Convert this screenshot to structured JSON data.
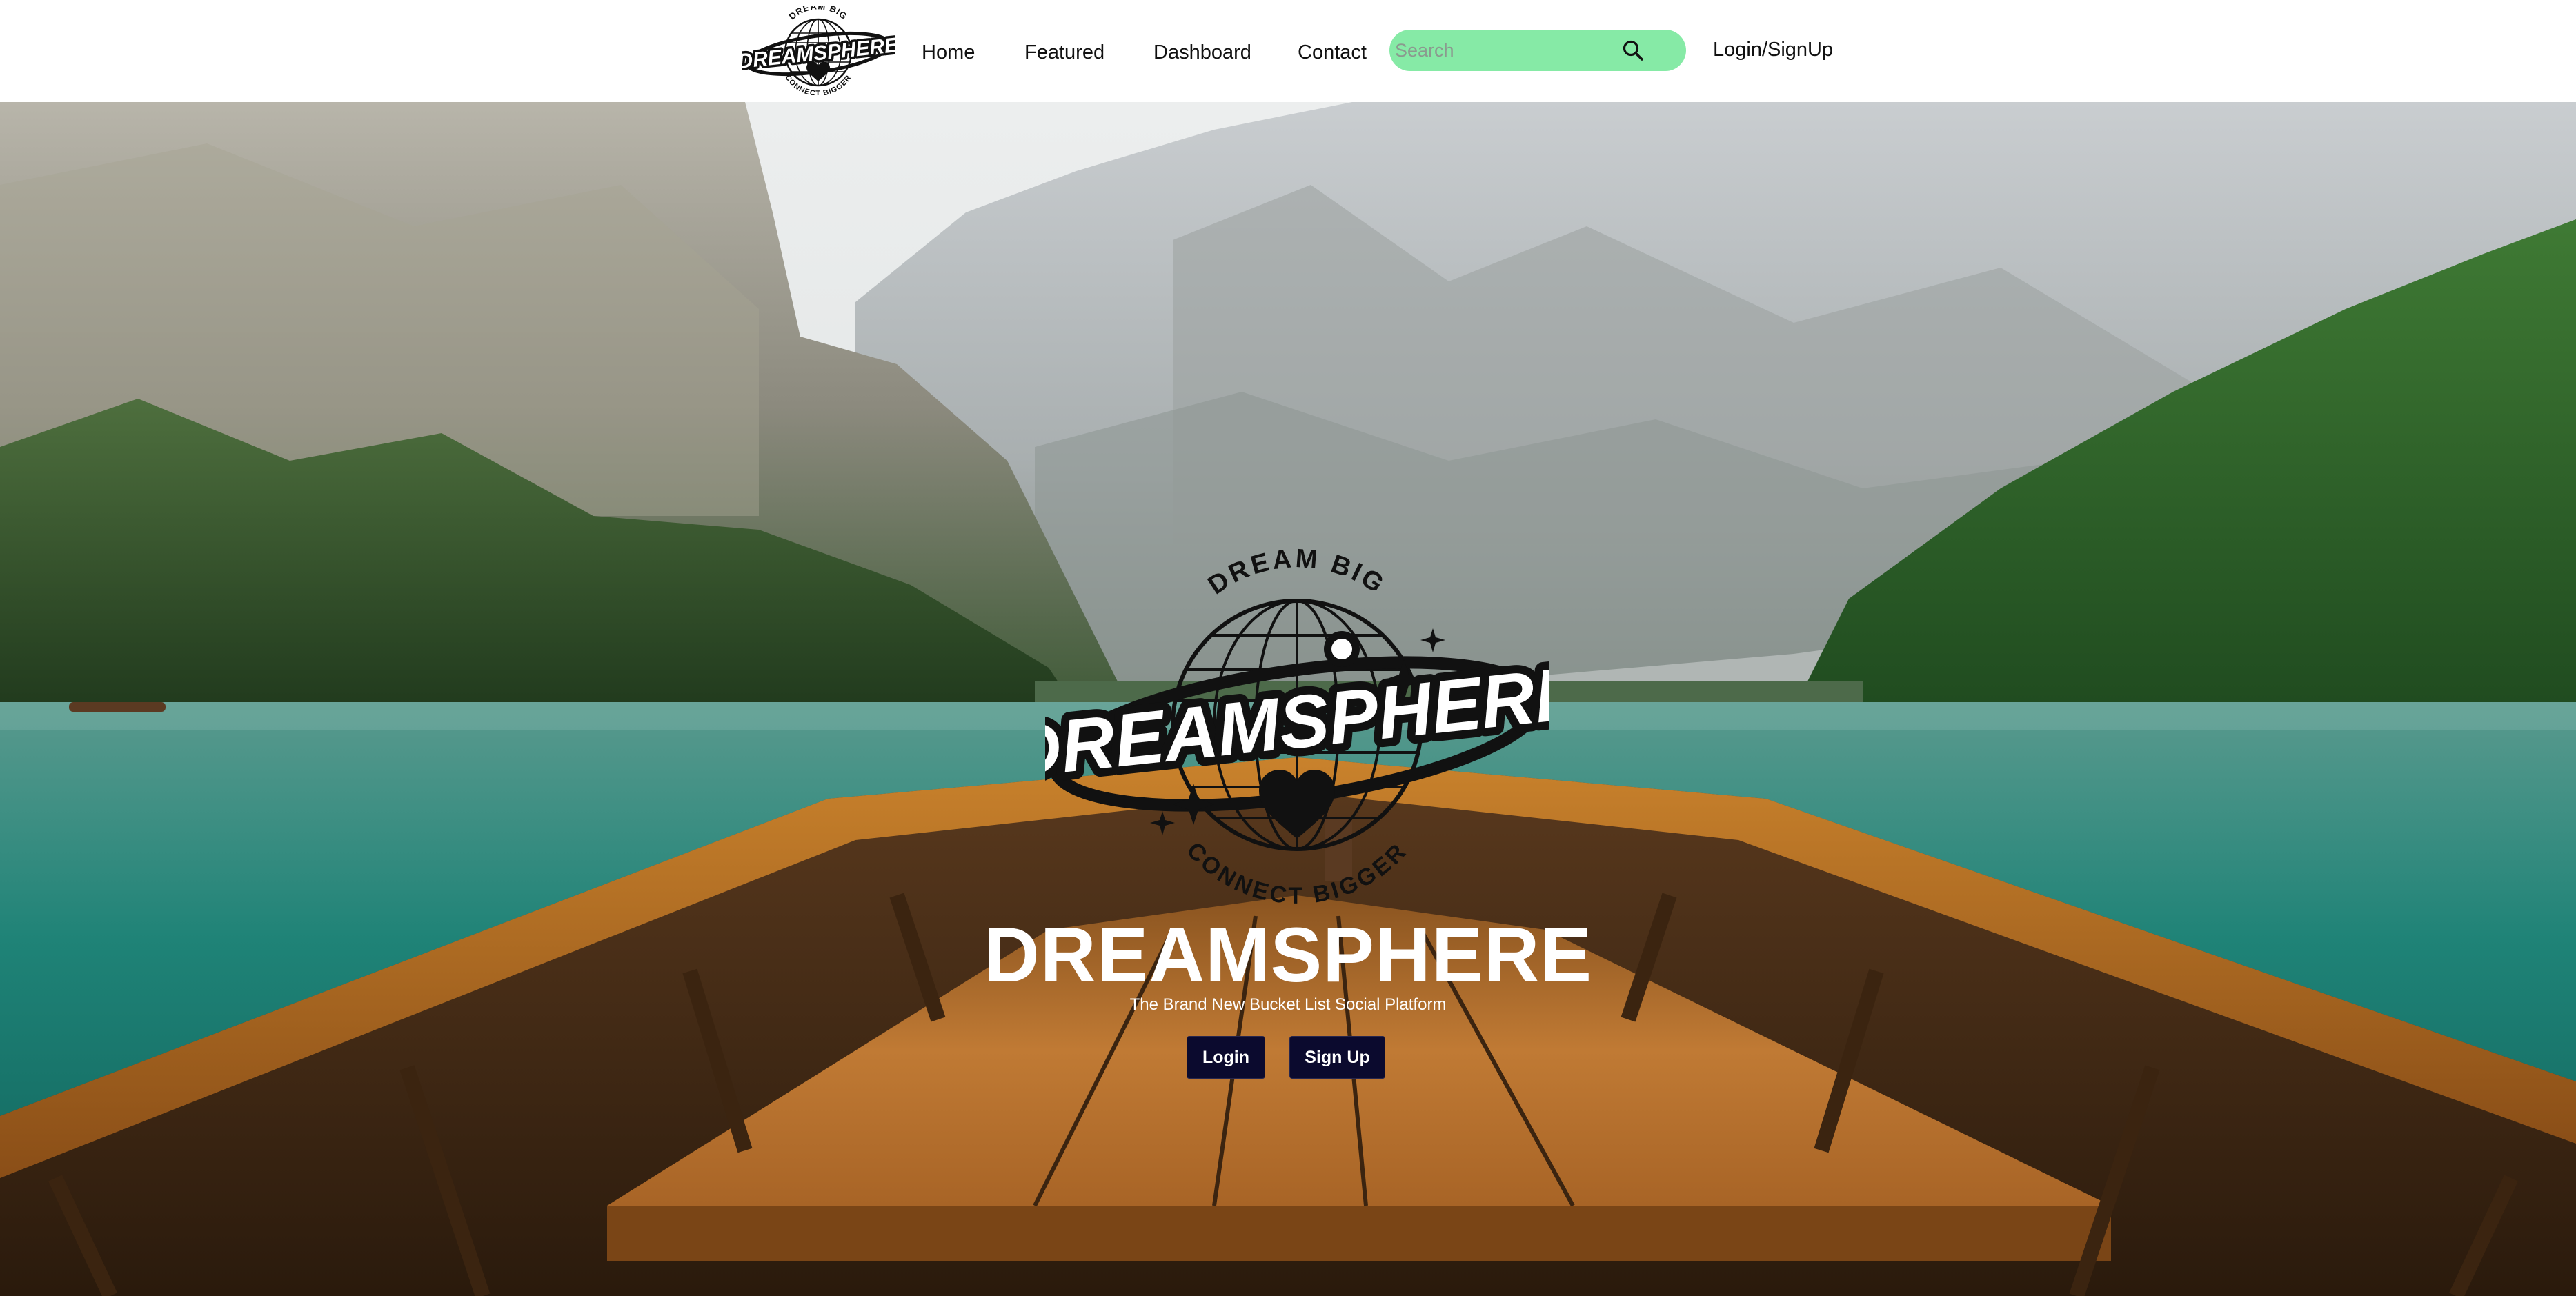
{
  "nav": {
    "logo_text": "DREAMSPHERE",
    "logo_top_text": "DREAM BIG",
    "logo_bottom_text": "CONNECT BIGGER",
    "links": [
      "Home",
      "Featured",
      "Dashboard",
      "Contact"
    ],
    "search_placeholder": "Search",
    "auth_label": "Login/SignUp"
  },
  "hero": {
    "logo_text": "DREAMSPHERE",
    "logo_top_text": "DREAM BIG",
    "logo_bottom_text": "CONNECT BIGGER",
    "title": "DREAMSPHERE",
    "subtitle": "The Brand New Bucket List Social Platform",
    "login_label": "Login",
    "signup_label": "Sign Up"
  },
  "colors": {
    "search_bg": "#86eaa6",
    "button_bg": "#0b0a2e",
    "text_light": "#ffffff"
  },
  "icons": [
    "search-icon",
    "logo-globe-icon",
    "heart-icon",
    "sparkle-icon"
  ]
}
